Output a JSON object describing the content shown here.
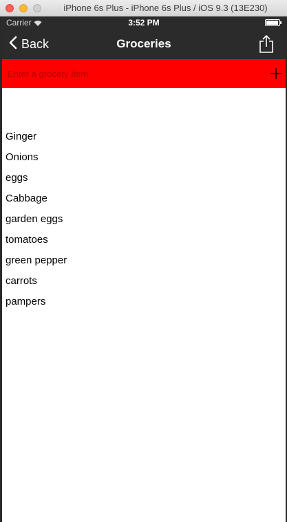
{
  "window": {
    "title": "iPhone 6s Plus - iPhone 6s Plus / iOS 9.3 (13E230)"
  },
  "status_bar": {
    "carrier": "Carrier",
    "time": "3:52 PM"
  },
  "nav_bar": {
    "back_label": "Back",
    "title": "Groceries"
  },
  "entry": {
    "placeholder": "Enter a grocery item",
    "value": ""
  },
  "groceries": [
    "Ginger",
    "Onions",
    "eggs",
    "Cabbage",
    "garden eggs",
    "tomatoes",
    "green pepper",
    "carrots",
    "pampers"
  ],
  "colors": {
    "entry_bar": "#ff0000",
    "nav_bar": "#2b2b2b",
    "nav_text": "#ffffff"
  },
  "icons": {
    "back": "chevron-left-icon",
    "share": "share-icon",
    "add": "plus-icon",
    "wifi": "wifi-icon",
    "battery": "battery-icon"
  }
}
